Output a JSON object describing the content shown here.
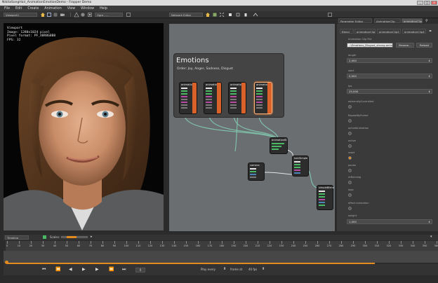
{
  "window": {
    "title": "NikitaSongHair_AnimationEmotionDemo - Frapper Demo",
    "controls": [
      "_",
      "□",
      "×"
    ]
  },
  "menu": [
    "File",
    "Edit",
    "Create",
    "Animation",
    "View",
    "Window",
    "Help"
  ],
  "toolbar": {
    "viewport_tab": "Viewport1",
    "render_dropdown": "Ogre - ...",
    "network_editor_tab": "Network Editor"
  },
  "viewport": {
    "info_title": "Viewport",
    "info_image": "Image: 1280x1024 pixel",
    "info_format": "Pixel format: PF_X8R8G8B8",
    "info_fps": "FPS: 32"
  },
  "network": {
    "group_title": "Emotions",
    "group_subtitle": "Order: Joy, Anger, Sadness, Disgust",
    "nodes": [
      {
        "label": "animation1"
      },
      {
        "label": "animation2"
      },
      {
        "label": "animation3"
      },
      {
        "label": "animation4"
      },
      {
        "label": "animationBl"
      },
      {
        "label": "camera"
      },
      {
        "label": "hairSimple"
      },
      {
        "label": "simpleBlend"
      }
    ]
  },
  "panel": {
    "tab_parameter_editor": "Parameter Editor",
    "tab_animation_clip": "AnimationClip",
    "tab_dropdown": "animationClip",
    "subtabs": [
      "Blend",
      "animationClip",
      "animationClip2",
      "animationClip4"
    ],
    "file_label": "Animation Clip File",
    "file_value": "..\\Emotions_Disgust_strong.anim",
    "browse_label": "Browse...",
    "reload_label": "Reload",
    "params": [
      {
        "label": "length",
        "value": "2,000",
        "kind": "spin"
      },
      {
        "label": "start",
        "value": "0,000",
        "kind": "spin"
      },
      {
        "label": "fps",
        "value": "25,000",
        "kind": "spin"
      },
      {
        "label": "externallyControlled",
        "kind": "check"
      },
      {
        "label": "RepeatByFrame",
        "kind": "check"
      },
      {
        "label": "activeAnimation",
        "kind": "check"
      },
      {
        "label": "active",
        "kind": "check"
      },
      {
        "label": "reset",
        "kind": "check"
      },
      {
        "label": "pause",
        "kind": "check"
      },
      {
        "label": "reRunning",
        "kind": "check"
      },
      {
        "label": "loop",
        "kind": "check"
      },
      {
        "label": "effect animation",
        "kind": "check"
      },
      {
        "label": "weight",
        "value": "1,000",
        "kind": "spin"
      }
    ]
  },
  "timeline": {
    "tab_label": "Timeline",
    "scales_label": "Scales:",
    "ticks": [
      "0",
      "10",
      "20",
      "30",
      "40",
      "50",
      "60",
      "70",
      "80",
      "90",
      "100",
      "110",
      "120",
      "130",
      "140",
      "150",
      "160",
      "170",
      "180",
      "190",
      "200",
      "210",
      "220",
      "230",
      "240",
      "250",
      "260",
      "270",
      "280",
      "290",
      "300",
      "310",
      "320",
      "330",
      "340",
      "350",
      "360"
    ],
    "current_frame": "0",
    "frame_rate_label": "Play every",
    "frames_label": "frame at",
    "fps_value": "40 fps",
    "accent_color": "#e48b20"
  }
}
